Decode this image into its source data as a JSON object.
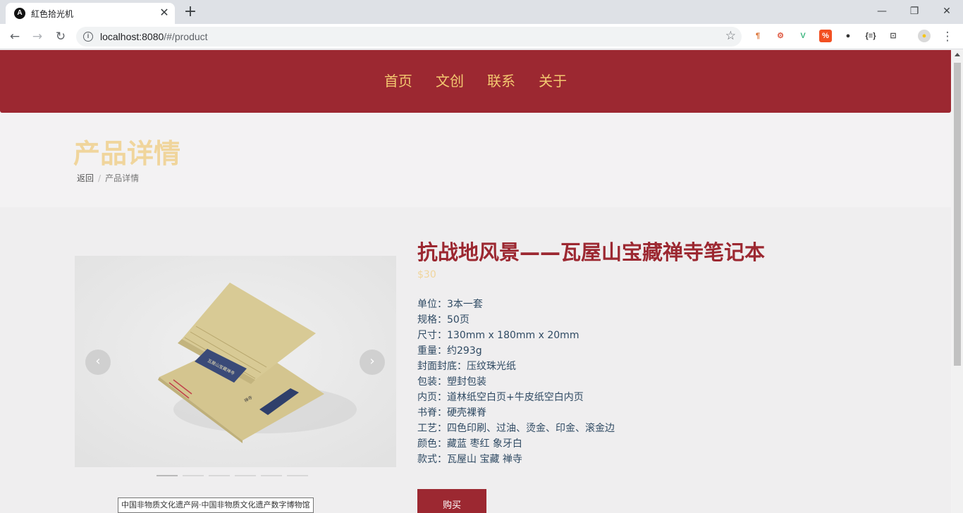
{
  "browser": {
    "tab_title": "紅色拾光机",
    "tab_favicon": "A",
    "url_host": "localhost:8080",
    "url_path": "/#/product",
    "extensions": [
      {
        "name": "pilcrow-extension-icon",
        "glyph": "¶",
        "color": "#d96b2b",
        "bg": "transparent"
      },
      {
        "name": "graph-extension-icon",
        "glyph": "⚙",
        "color": "#e0604a",
        "bg": "transparent"
      },
      {
        "name": "vue-devtools-icon",
        "glyph": "V",
        "color": "#41b883",
        "bg": "transparent"
      },
      {
        "name": "percent-extension-icon",
        "glyph": "%",
        "color": "#ffffff",
        "bg": "#f25022"
      },
      {
        "name": "circle-extension-icon",
        "glyph": "●",
        "color": "#333333",
        "bg": "transparent"
      },
      {
        "name": "json-extension-icon",
        "glyph": "{≡}",
        "color": "#333333",
        "bg": "transparent"
      },
      {
        "name": "terminal-extension-icon",
        "glyph": "⊡",
        "color": "#555555",
        "bg": "transparent"
      },
      {
        "name": "profile-avatar-icon",
        "glyph": "●",
        "color": "#f5c518",
        "bg": "#d9d9d9"
      }
    ]
  },
  "nav": {
    "items": [
      "首页",
      "文创",
      "联系",
      "关于"
    ]
  },
  "page": {
    "title": "产品详情",
    "breadcrumb": {
      "back": "返回",
      "separator": "/",
      "current": "产品详情"
    }
  },
  "product": {
    "name": "抗战地风景——瓦屋山宝藏禅寺笔记本",
    "price": "$30",
    "specs": [
      "单位：3本一套",
      "规格：50页",
      "尺寸：130mm x 180mm x 20mm",
      "重量：约293g",
      "封面封底：压纹珠光纸",
      "包装：塑封包装",
      "内页：道林纸空白页+牛皮纸空白内页",
      "书脊：硬壳裸脊",
      "工艺：四色印刷、过油、烫金、印金、滚金边",
      "颜色：藏蓝 枣红 象牙白",
      "款式：瓦屋山 宝藏 禅寺"
    ],
    "buy_label": "购买"
  },
  "carousel": {
    "prev": "‹",
    "next": "›",
    "slide_count": 6,
    "active_index": 0
  },
  "tooltip": "中国非物质文化遗产网·中国非物质文化遗产数字博物馆",
  "colors": {
    "brand_red": "#9c2831",
    "gold": "#f3c870",
    "pale_gold": "#f0d59c",
    "spec_text": "#2f4a63"
  }
}
